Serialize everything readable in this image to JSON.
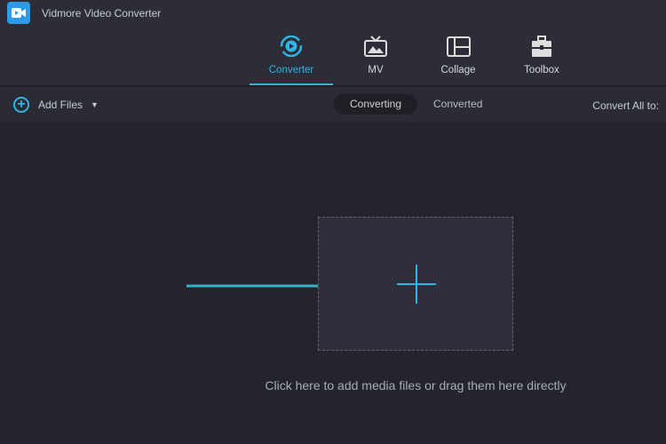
{
  "app": {
    "title": "Vidmore Video Converter"
  },
  "tabs": [
    {
      "label": "Converter",
      "icon": "converter-icon"
    },
    {
      "label": "MV",
      "icon": "tv-icon"
    },
    {
      "label": "Collage",
      "icon": "collage-icon"
    },
    {
      "label": "Toolbox",
      "icon": "toolbox-icon"
    }
  ],
  "toolbar": {
    "add_files": "Add Files",
    "segments": [
      "Converting",
      "Converted"
    ],
    "right_label": "Convert All to:"
  },
  "main": {
    "hint": "Click here to add media files or drag them here directly"
  },
  "colors": {
    "accent": "#2fb5e6",
    "background": "#24252c"
  }
}
